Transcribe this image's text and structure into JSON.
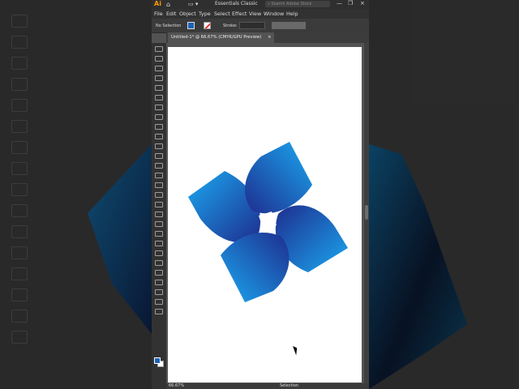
{
  "app": {
    "logo": "Ai",
    "workspace": "Essentials Classic",
    "search_placeholder": "Search Adobe Stock"
  },
  "menu": [
    "File",
    "Edit",
    "Object",
    "Type",
    "Select",
    "Effect",
    "View",
    "Window",
    "Help"
  ],
  "control_bar": {
    "selection_label": "No Selection",
    "stroke_label": "Stroke:"
  },
  "document_tab": {
    "title": "Untitled-1* @ 66.67% (CMYK/GPU Preview)"
  },
  "status_bar": {
    "zoom": "66.67%",
    "tool": "Selection"
  },
  "colors": {
    "fill": "#1c62b8",
    "artwork_light": "#1aa8f0",
    "artwork_dark": "#1e2d8f"
  },
  "icons": [
    "home-icon",
    "search-icon",
    "cursor-icon"
  ]
}
